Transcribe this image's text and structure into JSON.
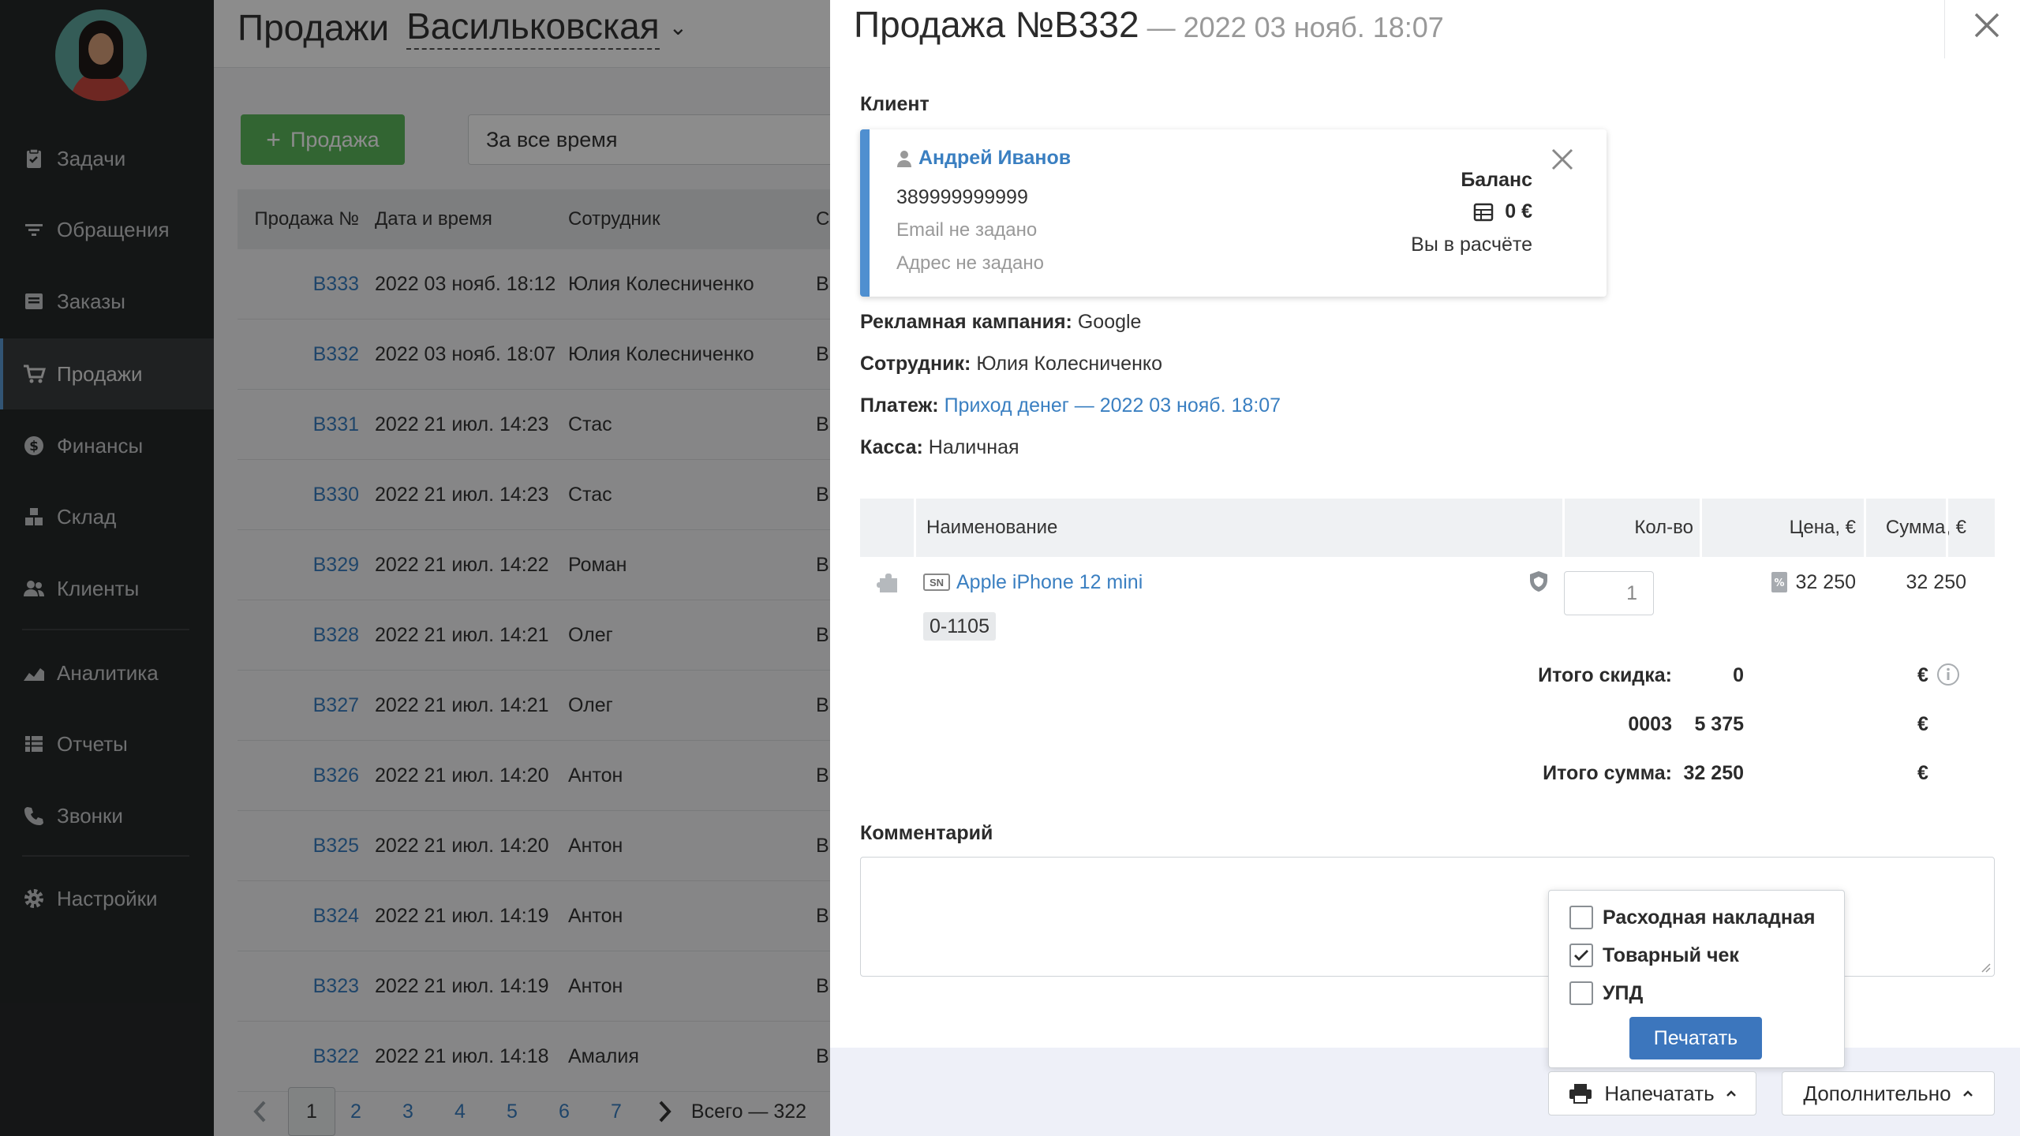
{
  "sidebar": {
    "items": [
      {
        "label": "Задачи",
        "icon": "clipboard-icon"
      },
      {
        "label": "Обращения",
        "icon": "filter-icon"
      },
      {
        "label": "Заказы",
        "icon": "orders-icon"
      },
      {
        "label": "Продажи",
        "icon": "cart-icon"
      },
      {
        "label": "Финансы",
        "icon": "dollar-icon"
      },
      {
        "label": "Склад",
        "icon": "warehouse-icon"
      },
      {
        "label": "Клиенты",
        "icon": "users-icon"
      },
      {
        "label": "Аналитика",
        "icon": "chart-icon"
      },
      {
        "label": "Отчеты",
        "icon": "reports-icon"
      },
      {
        "label": "Звонки",
        "icon": "phone-icon"
      },
      {
        "label": "Настройки",
        "icon": "gear-icon"
      }
    ],
    "active": "Продажи"
  },
  "list": {
    "title": "Продажи",
    "shop": "Васильковская",
    "add_button": "Продажа",
    "period": "За все время",
    "columns": [
      "Продажа №",
      "Дата и время",
      "Сотрудник",
      "С"
    ],
    "rows": [
      {
        "num": "B333",
        "date": "2022 03 нояб. 18:12",
        "employee": "Юлия Колесниченко",
        "extra": "B"
      },
      {
        "num": "B332",
        "date": "2022 03 нояб. 18:07",
        "employee": "Юлия Колесниченко",
        "extra": "B"
      },
      {
        "num": "B331",
        "date": "2022 21 июл. 14:23",
        "employee": "Стас",
        "extra": "B"
      },
      {
        "num": "B330",
        "date": "2022 21 июл. 14:23",
        "employee": "Стас",
        "extra": "B"
      },
      {
        "num": "B329",
        "date": "2022 21 июл. 14:22",
        "employee": "Роман",
        "extra": "B"
      },
      {
        "num": "B328",
        "date": "2022 21 июл. 14:21",
        "employee": "Олег",
        "extra": "B"
      },
      {
        "num": "B327",
        "date": "2022 21 июл. 14:21",
        "employee": "Олег",
        "extra": "B"
      },
      {
        "num": "B326",
        "date": "2022 21 июл. 14:20",
        "employee": "Антон",
        "extra": "B"
      },
      {
        "num": "B325",
        "date": "2022 21 июл. 14:20",
        "employee": "Антон",
        "extra": "B"
      },
      {
        "num": "B324",
        "date": "2022 21 июл. 14:19",
        "employee": "Антон",
        "extra": "B"
      },
      {
        "num": "B323",
        "date": "2022 21 июл. 14:19",
        "employee": "Антон",
        "extra": "B"
      },
      {
        "num": "B322",
        "date": "2022 21 июл. 14:18",
        "employee": "Амалия",
        "extra": "B"
      }
    ],
    "pages": [
      "1",
      "2",
      "3",
      "4",
      "5",
      "6",
      "7"
    ],
    "current_page": "1",
    "total": "Всего — 322"
  },
  "modal": {
    "title": "Продажа №B332",
    "date": "— 2022 03 нояб. 18:07",
    "client_label": "Клиент",
    "client": {
      "name": "Андрей Иванов",
      "phone": "389999999999",
      "email": "Email не задано",
      "address": "Адрес не задано",
      "balance_label": "Баланс",
      "balance_value": "0 €",
      "balance_status": "Вы в расчёте"
    },
    "campaign_label": "Рекламная кампания:",
    "campaign_value": "Google",
    "employee_label": "Сотрудник:",
    "employee_value": "Юлия Колесниченко",
    "payment_label": "Платеж:",
    "payment_value": "Приход денег — 2022 03 нояб. 18:07",
    "cashbox_label": "Касса:",
    "cashbox_value": "Наличная",
    "items_columns": {
      "name": "Наименование",
      "qty": "Кол-во",
      "price": "Цена, €",
      "sum": "Сумма, €"
    },
    "items": [
      {
        "sn_badge": "SN",
        "name": "Apple iPhone 12 mini",
        "serial": "0-1105",
        "qty": "1",
        "price": "32 250",
        "sum": "32 250"
      }
    ],
    "totals": {
      "discount_label": "Итого скидка:",
      "discount_value": "0",
      "discount_currency": "€",
      "code_label": "0003",
      "code_value": "5 375",
      "code_currency": "€",
      "sum_label": "Итого сумма:",
      "sum_value": "32 250",
      "sum_currency": "€"
    },
    "comment_label": "Комментарий",
    "print_options": [
      {
        "label": "Расходная накладная",
        "checked": false
      },
      {
        "label": "Товарный чек",
        "checked": true
      },
      {
        "label": "УПД",
        "checked": false
      }
    ],
    "print_button": "Печатать",
    "footer": {
      "print_menu": "Напечатать",
      "more_menu": "Дополнительно"
    }
  },
  "colors": {
    "accent": "#3a7fc1",
    "success": "#5cb85c",
    "sidebar_bg": "#262829",
    "primary_button": "#3c76bd"
  }
}
